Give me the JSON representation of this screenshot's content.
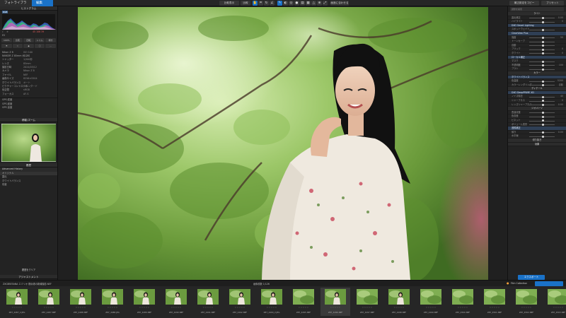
{
  "topbar": {
    "tab_library": "フォトライブラリ",
    "tab_edit": "編集",
    "compare_label": "比較表示",
    "compare_short": "比較",
    "fit_label": "画面に合わせる",
    "zoom_label": "100%",
    "right_btn_1": "補正設定をコピー",
    "right_btn_2": "プリセット"
  },
  "left": {
    "histogram_title": "ヒストグラム",
    "hist_mode": "RGB",
    "info_values": "45   106   39",
    "ev_label": "EV",
    "tool_row1": [
      "100%",
      "比較",
      "回転",
      "トリム",
      "傾き"
    ],
    "tool_row2": [
      "",
      "",
      "",
      "",
      ""
    ],
    "info_rows": [
      {
        "k": "Nikon Z 8",
        "v": "ISO 100"
      },
      {
        "k": "NIKKOR Z 85mm f/1.2 S",
        "v": "f/1.8"
      },
      {
        "k": "シャッター",
        "v": "1/200秒"
      },
      {
        "k": "レンズ",
        "v": "85mm"
      },
      {
        "k": "撮影日時",
        "v": "2024/05/12"
      },
      {
        "k": "カメラ",
        "v": "Nikon Z 8"
      },
      {
        "k": "ファイル",
        "v": "NEF"
      },
      {
        "k": "画像サイズ",
        "v": "8256×5504"
      },
      {
        "k": "ホワイトバランス",
        "v": "オート"
      },
      {
        "k": "ピクチャーコントロール",
        "v": "スタンダード"
      },
      {
        "k": "色空間",
        "v": "sRGB"
      },
      {
        "k": "フォーカス",
        "v": "AF-S"
      }
    ],
    "gps_rows": [
      "GPS 緯度",
      "GPS 経度",
      "GPS 高度"
    ],
    "navigator_title": "移動/ズーム",
    "history_title": "履歴",
    "history_items": [
      "Advanced History",
      "オリジナル",
      "露出",
      "ホワイトバランス",
      "彩度"
    ],
    "history_button": "履歴をクリア",
    "adjust_title": "アジャストメント"
  },
  "viewer": {
    "status_center": "画像枚数   1/126"
  },
  "right": {
    "search_placeholder": "調整を検索",
    "rows": [
      {
        "label": "ライト",
        "type": "sec"
      },
      {
        "label": "露出補正",
        "value": "0.00"
      },
      {
        "label": "ハイライト",
        "value": "0"
      },
      {
        "label": "DXO Smart Lighting",
        "type": "hl"
      },
      {
        "label": "スポットウェイト",
        "value": ""
      },
      {
        "label": "ClearView Plus",
        "type": "hl"
      },
      {
        "label": "強度",
        "value": "50"
      },
      {
        "label": "トーンカーブ",
        "value": ""
      },
      {
        "label": "自動",
        "value": ""
      },
      {
        "label": "ブラック",
        "value": "0"
      },
      {
        "label": "ホワイト",
        "value": "0"
      },
      {
        "label": "ローカル補正",
        "type": "hl"
      },
      {
        "label": "マスク",
        "value": ""
      },
      {
        "label": "不透明度",
        "value": "100"
      },
      {
        "label": "ブラシ",
        "value": ""
      },
      {
        "label": "カラー",
        "type": "sec"
      },
      {
        "label": "ホワイトバランス",
        "type": "hl"
      },
      {
        "label": "色温度",
        "value": "5200"
      },
      {
        "label": "カラーレンダリング",
        "value": "自動"
      },
      {
        "label": "ディテール",
        "type": "sec"
      },
      {
        "label": "DXO DeepPRIME XD",
        "type": "hl"
      },
      {
        "label": "ノイズ除去",
        "value": "40"
      },
      {
        "label": "シャープネス",
        "value": "0"
      },
      {
        "label": "レンズシャープネス",
        "value": "0.00"
      },
      {
        "label": "ジオメトリ",
        "type": "sec"
      },
      {
        "label": "歪曲収差",
        "value": ""
      },
      {
        "label": "色収差",
        "value": ""
      },
      {
        "label": "ビネット",
        "value": ""
      },
      {
        "label": "ボリューム変形",
        "value": ""
      },
      {
        "label": "透視補正",
        "type": "hl"
      },
      {
        "label": "傾き",
        "value": "0.00"
      },
      {
        "label": "水平線",
        "value": ""
      },
      {
        "label": "切り抜き",
        "type": "sec"
      },
      {
        "label": "効果",
        "type": "sec"
      }
    ],
    "export_label": "エクスポート"
  },
  "status": {
    "left_text": "ZXC8BE5ANA エミリオ 横浜港の新緑撮影.NEF",
    "center_text": "画像枚数   1/126",
    "collection_label": "Film Collection"
  },
  "filmstrip": {
    "thumbs": [
      {
        "name": "Z87_4487_2.JPG",
        "sel": false
      },
      {
        "name": "Z87_4487.NEF",
        "sel": false
      },
      {
        "name": "Z87_4488.NEF",
        "sel": false
      },
      {
        "name": "Z87_4488.JPG",
        "sel": false
      },
      {
        "name": "Z87_4489.NEF",
        "sel": false
      },
      {
        "name": "Z87_4490.NEF",
        "sel": false
      },
      {
        "name": "Z87_4491.NEF",
        "sel": false
      },
      {
        "name": "Z87_4492.NEF",
        "sel": false
      },
      {
        "name": "Z87_4494_2.JPG",
        "sel": false
      },
      {
        "name": "Z87_4495.NEF",
        "sel": false
      },
      {
        "name": "Z87_4496.NEF",
        "sel": true
      },
      {
        "name": "Z87_4497.NEF",
        "sel": false
      },
      {
        "name": "Z87_4498.NEF",
        "sel": false
      },
      {
        "name": "Z87_4499.NEF",
        "sel": false
      },
      {
        "name": "Z87_4500.NEF",
        "sel": false
      },
      {
        "name": "Z87_4501.NEF",
        "sel": false
      },
      {
        "name": "Z87_4502.NEF",
        "sel": false
      },
      {
        "name": "Z87_4503.NEF",
        "sel": false
      }
    ],
    "stars": "☆☆☆☆☆"
  },
  "colors": {
    "accent": "#1a72c8",
    "panel": "#232323",
    "foliage": "#6e9c42"
  }
}
